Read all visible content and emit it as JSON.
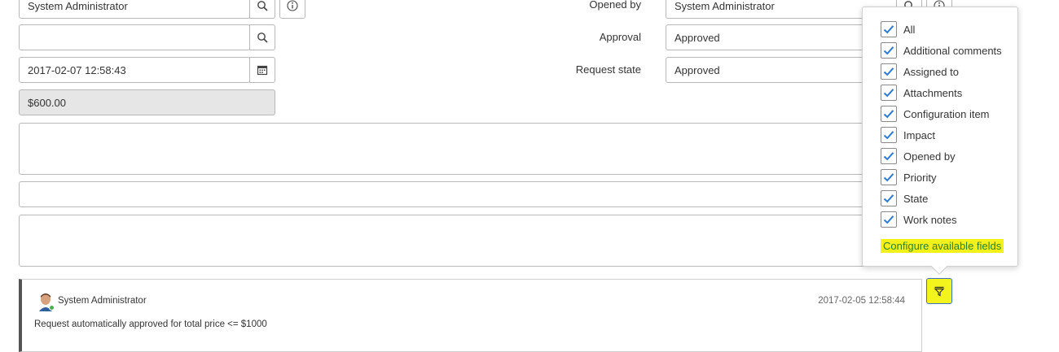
{
  "form": {
    "requested_for": "System Administrator",
    "location": "",
    "due_date": "2017-02-07 12:58:43",
    "price": "$600.00",
    "opened_by_label": "Opened by",
    "opened_by": "System Administrator",
    "approval_label": "Approval",
    "approval": "Approved",
    "request_state_label": "Request state",
    "request_state": "Approved"
  },
  "filter_menu": {
    "items": [
      {
        "label": "All",
        "checked": true
      },
      {
        "label": "Additional comments",
        "checked": true
      },
      {
        "label": "Assigned to",
        "checked": true
      },
      {
        "label": "Attachments",
        "checked": true
      },
      {
        "label": "Configuration item",
        "checked": true
      },
      {
        "label": "Impact",
        "checked": true
      },
      {
        "label": "Opened by",
        "checked": true
      },
      {
        "label": "Priority",
        "checked": true
      },
      {
        "label": "State",
        "checked": true
      },
      {
        "label": "Work notes",
        "checked": true
      }
    ],
    "configure_link": "Configure available fields"
  },
  "activity": {
    "author": "System Administrator",
    "timestamp": "2017-02-05 12:58:44",
    "message": "Request automatically approved for total price <= $1000"
  },
  "colors": {
    "checkbox_check": "#2b7bd6",
    "highlight": "#f2f21a",
    "link_green": "#2e7d32",
    "presence_green": "#4caf50"
  }
}
